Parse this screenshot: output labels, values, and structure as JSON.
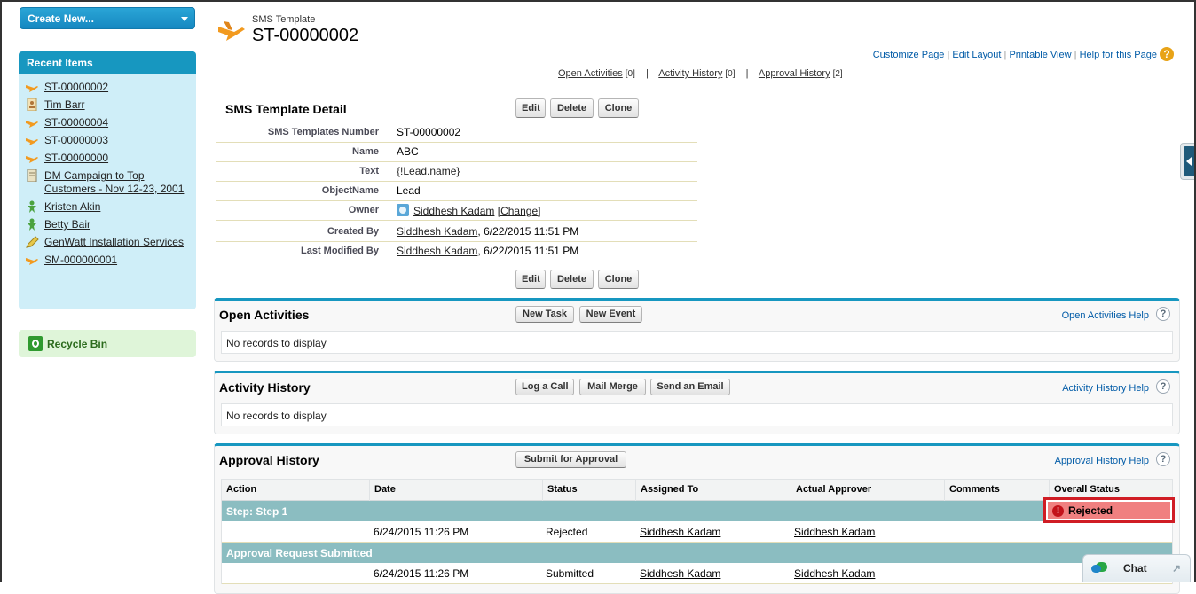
{
  "sidebar": {
    "create_new": "Create New...",
    "recent_title": "Recent Items",
    "recent_items": [
      {
        "label": "ST-00000002",
        "icon": "plane-icon"
      },
      {
        "label": "Tim Barr",
        "icon": "contact-card-icon"
      },
      {
        "label": "ST-00000004",
        "icon": "plane-icon"
      },
      {
        "label": "ST-00000003",
        "icon": "plane-icon"
      },
      {
        "label": "ST-00000000",
        "icon": "plane-icon"
      },
      {
        "label": "DM Campaign to Top Customers - Nov 12-23, 2001",
        "icon": "document-icon"
      },
      {
        "label": "Kristen Akin",
        "icon": "person-icon"
      },
      {
        "label": "Betty Bair",
        "icon": "person-icon"
      },
      {
        "label": "GenWatt Installation Services",
        "icon": "pencil-icon"
      },
      {
        "label": "SM-000000001",
        "icon": "plane-icon"
      }
    ],
    "recycle_bin": "Recycle Bin"
  },
  "header": {
    "object_type": "SMS Template",
    "record_name": "ST-00000002",
    "top_links": [
      "Customize Page",
      "Edit Layout",
      "Printable View",
      "Help for this Page"
    ],
    "related_links": [
      {
        "label": "Open Activities",
        "count": "[0]"
      },
      {
        "label": "Activity History",
        "count": "[0]"
      },
      {
        "label": "Approval History",
        "count": "[2]"
      }
    ],
    "help_icon_glyph": "?"
  },
  "detail": {
    "title": "SMS Template Detail",
    "buttons": {
      "edit": "Edit",
      "delete": "Delete",
      "clone": "Clone"
    },
    "fields": {
      "number_label": "SMS Templates Number",
      "number_value": "ST-00000002",
      "name_label": "Name",
      "name_value": "ABC",
      "text_label": "Text",
      "text_value": "{!Lead.name}",
      "objectname_label": "ObjectName",
      "objectname_value": "Lead",
      "owner_label": "Owner",
      "owner_value": "Siddhesh Kadam",
      "owner_change": "[Change]",
      "created_label": "Created By",
      "created_user": "Siddhesh Kadam",
      "created_date": ", 6/22/2015 11:51 PM",
      "modified_label": "Last Modified By",
      "modified_user": "Siddhesh Kadam",
      "modified_date": ", 6/22/2015 11:51 PM"
    }
  },
  "open_activities": {
    "title": "Open Activities",
    "buttons": {
      "new_task": "New Task",
      "new_event": "New Event"
    },
    "help": "Open Activities Help",
    "empty": "No records to display"
  },
  "activity_history": {
    "title": "Activity History",
    "buttons": {
      "log_call": "Log a Call",
      "mail_merge": "Mail Merge",
      "send_email": "Send an Email"
    },
    "help": "Activity History Help",
    "empty": "No records to display"
  },
  "approval_history": {
    "title": "Approval History",
    "buttons": {
      "submit": "Submit for Approval"
    },
    "help": "Approval History Help",
    "columns": [
      "Action",
      "Date",
      "Status",
      "Assigned To",
      "Actual Approver",
      "Comments",
      "Overall Status"
    ],
    "steps": [
      {
        "label": "Step: Step 1",
        "overall_status": "Rejected",
        "row": {
          "action": "",
          "date": "6/24/2015 11:26 PM",
          "status": "Rejected",
          "assigned_to": "Siddhesh Kadam",
          "actual_approver": "Siddhesh Kadam",
          "comments": ""
        }
      },
      {
        "label": "Approval Request Submitted",
        "row": {
          "action": "",
          "date": "6/24/2015 11:26 PM",
          "status": "Submitted",
          "assigned_to": "Siddhesh Kadam",
          "actual_approver": "Siddhesh Kadam",
          "comments": ""
        }
      }
    ]
  },
  "chat": {
    "label": "Chat",
    "popout_glyph": "↗"
  },
  "colors": {
    "accent": "#1797c0",
    "link": "#015ba7",
    "rejected_bg": "#f08080",
    "highlight_border": "#d01c24",
    "step_row": "#8bbdc1"
  }
}
